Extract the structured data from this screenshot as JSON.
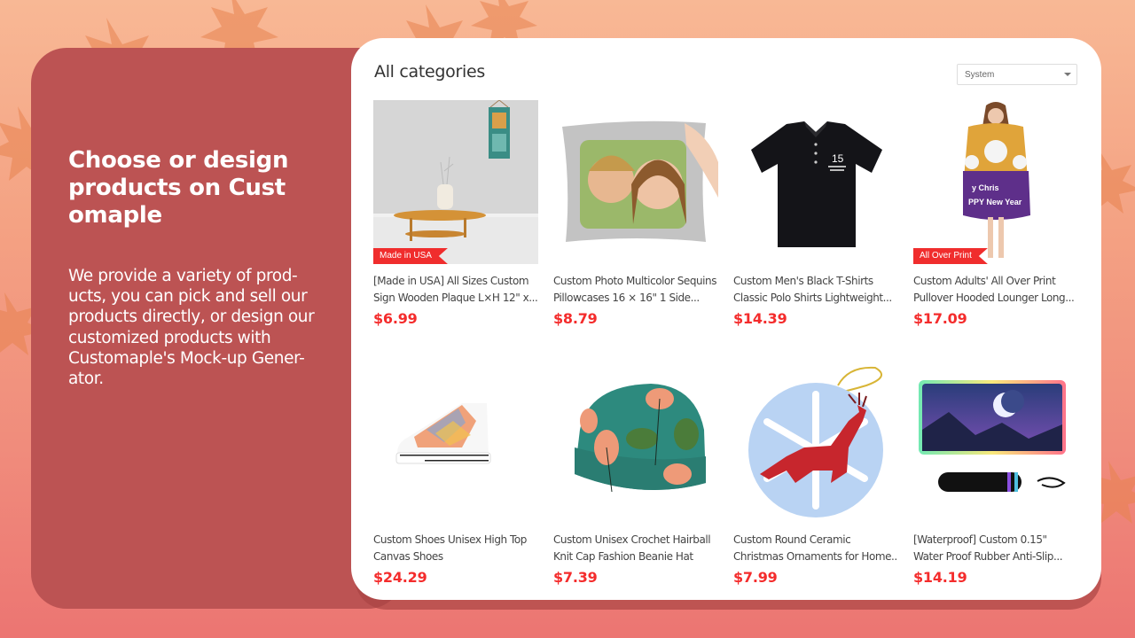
{
  "hero": {
    "title": "Choose or design products on Cust omaple",
    "description": "We provide a variety of prod- ucts, you can pick and sell our products directly, or design our customized products with Customaple's Mock-up Gener- ator."
  },
  "store": {
    "category_title": "All categories",
    "sort": {
      "selected": "System",
      "icon": "chevron-down-icon"
    },
    "products": [
      {
        "name_line1": "[Made in USA] All Sizes Custom",
        "name_line2": "Sign Wooden Plaque L×H 12\" x...",
        "price": "$6.99",
        "badge": "Made in USA",
        "image": "wooden-plaque-image"
      },
      {
        "name_line1": "Custom Photo Multicolor Sequins",
        "name_line2": "Pillowcases 16 × 16\" 1 Side...",
        "price": "$8.79",
        "badge": null,
        "image": "sequin-pillow-image"
      },
      {
        "name_line1": "Custom Men's Black T-Shirts",
        "name_line2": "Classic Polo Shirts Lightweight...",
        "price": "$14.39",
        "badge": null,
        "image": "polo-shirt-image"
      },
      {
        "name_line1": "Custom Adults' All Over Print",
        "name_line2": "Pullover Hooded Lounger Long...",
        "price": "$17.09",
        "badge": "All Over Print",
        "image": "hooded-lounger-image"
      },
      {
        "name_line1": "Custom Shoes Unisex High Top",
        "name_line2": "Canvas Shoes",
        "price": "$24.29",
        "badge": null,
        "image": "canvas-shoe-image"
      },
      {
        "name_line1": "Custom Unisex Crochet Hairball",
        "name_line2": "Knit Cap Fashion Beanie Hat",
        "price": "$7.39",
        "badge": null,
        "image": "beanie-hat-image"
      },
      {
        "name_line1": "Custom Round Ceramic",
        "name_line2": "Christmas Ornaments for Home...",
        "price": "$7.99",
        "badge": null,
        "image": "ceramic-ornament-image"
      },
      {
        "name_line1": "[Waterproof] Custom 0.15\"",
        "name_line2": "Water Proof Rubber Anti-Slip...",
        "price": "$14.19",
        "badge": null,
        "image": "rgb-mousepad-image"
      }
    ]
  },
  "colors": {
    "panel": "#bc5353",
    "price": "#f42c2c",
    "badge": "#f02d2d",
    "background_top": "#f8b895",
    "background_bottom": "#ec7572"
  }
}
